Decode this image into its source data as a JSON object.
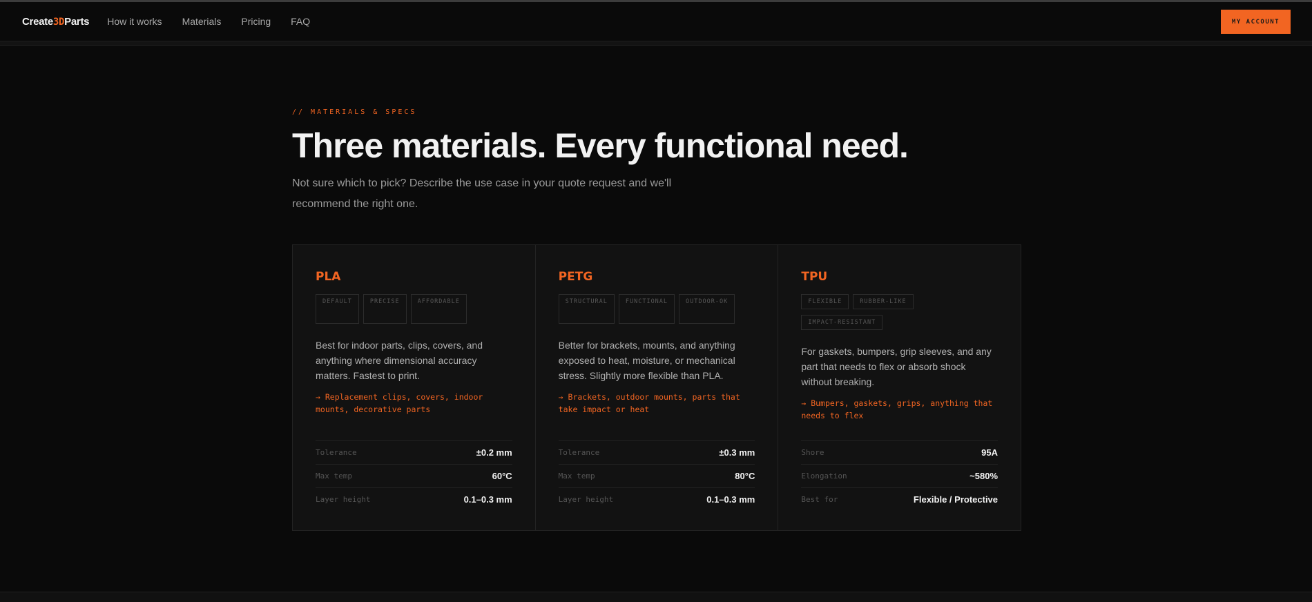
{
  "nav": {
    "logo_pre": "Create",
    "logo_accent": "3D",
    "logo_post": "Parts",
    "links": [
      "How it works",
      "Materials",
      "Pricing",
      "FAQ"
    ],
    "account": "MY ACCOUNT"
  },
  "hero": {
    "eyebrow": "// MATERIALS & SPECS",
    "title": "Three materials. Every functional need.",
    "subtitle": "Not sure which to pick? Describe the use case in your quote request and we'll recommend the right one."
  },
  "colors": {
    "accent": "#f26522",
    "bg": "#0a0a0a",
    "card": "#121212"
  },
  "cards": [
    {
      "name": "PLA",
      "tags": [
        "DEFAULT",
        "PRECISE",
        "AFFORDABLE"
      ],
      "desc": "Best for indoor parts, clips, covers, and anything where dimensional accuracy matters. Fastest to print.",
      "use": "→ Replacement clips, covers, indoor mounts, decorative parts",
      "specs": [
        {
          "label": "Tolerance",
          "value": "±0.2 mm"
        },
        {
          "label": "Max temp",
          "value": "60°C"
        },
        {
          "label": "Layer height",
          "value": "0.1–0.3 mm"
        }
      ]
    },
    {
      "name": "PETG",
      "tags": [
        "STRUCTURAL",
        "FUNCTIONAL",
        "OUTDOOR-OK"
      ],
      "desc": "Better for brackets, mounts, and anything exposed to heat, moisture, or mechanical stress. Slightly more flexible than PLA.",
      "use": "→ Brackets, outdoor mounts, parts that take impact or heat",
      "specs": [
        {
          "label": "Tolerance",
          "value": "±0.3 mm"
        },
        {
          "label": "Max temp",
          "value": "80°C"
        },
        {
          "label": "Layer height",
          "value": "0.1–0.3 mm"
        }
      ]
    },
    {
      "name": "TPU",
      "tags": [
        "FLEXIBLE",
        "RUBBER-LIKE",
        "IMPACT-RESISTANT"
      ],
      "desc": "For gaskets, bumpers, grip sleeves, and any part that needs to flex or absorb shock without breaking.",
      "use": "→ Bumpers, gaskets, grips, anything that needs to flex",
      "specs": [
        {
          "label": "Shore",
          "value": "95A"
        },
        {
          "label": "Elongation",
          "value": "~580%"
        },
        {
          "label": "Best for",
          "value": "Flexible / Protective"
        }
      ]
    }
  ]
}
